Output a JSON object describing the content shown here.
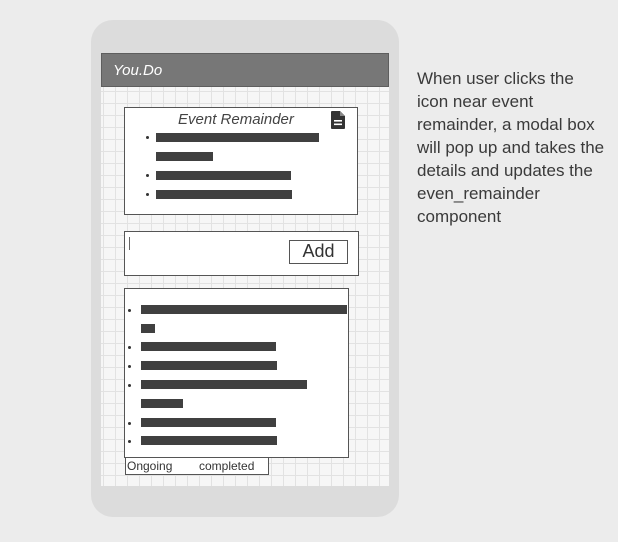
{
  "app": {
    "title": "You.Do"
  },
  "event_reminder": {
    "title": "Event Remainder",
    "icon": "document-icon"
  },
  "input": {
    "value": "",
    "add_label": "Add"
  },
  "tabs": {
    "ongoing": "Ongoing",
    "completed": "completed"
  },
  "annotation": "When user clicks the icon near event remainder, a modal box will pop up and takes the details and updates the even_remainder component",
  "colors": {
    "appbar": "#777777",
    "placeholder_bar": "#404040",
    "phone": "#dcdcdc"
  }
}
